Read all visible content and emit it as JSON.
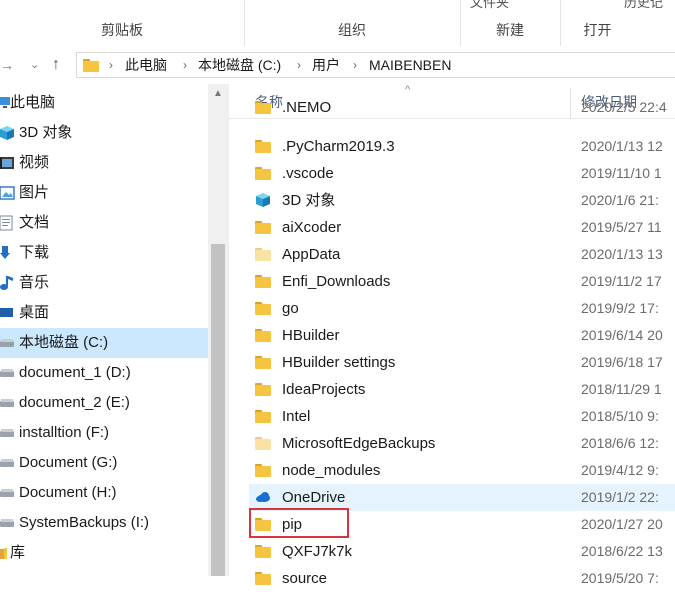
{
  "ribbon": {
    "groups": [
      {
        "label": "剪贴板"
      },
      {
        "label": "组织"
      },
      {
        "label": "新建",
        "top_stub": "文件夹"
      },
      {
        "label": "打开",
        "top_stub": "历史记"
      }
    ]
  },
  "address": {
    "back_icon": "back-arrow-icon",
    "forward_icon": "chevron-down-icon",
    "up_icon": "up-arrow-icon",
    "breadcrumbs": [
      "此电脑",
      "本地磁盘 (C:)",
      "用户",
      "MAIBENBEN"
    ]
  },
  "nav_pane": {
    "items": [
      {
        "label": "此电脑",
        "icon": "computer-icon"
      },
      {
        "label": "3D 对象",
        "icon": "cube-3d-icon"
      },
      {
        "label": "视频",
        "icon": "video-icon"
      },
      {
        "label": "图片",
        "icon": "pictures-icon"
      },
      {
        "label": "文档",
        "icon": "documents-icon"
      },
      {
        "label": "下载",
        "icon": "download-icon"
      },
      {
        "label": "音乐",
        "icon": "music-icon"
      },
      {
        "label": "桌面",
        "icon": "desktop-icon"
      },
      {
        "label": "本地磁盘 (C:)",
        "icon": "drive-icon",
        "selected": true
      },
      {
        "label": "document_1 (D:)",
        "icon": "drive-icon"
      },
      {
        "label": "document_2 (E:)",
        "icon": "drive-icon"
      },
      {
        "label": "installtion (F:)",
        "icon": "drive-icon"
      },
      {
        "label": "Document (G:)",
        "icon": "drive-icon"
      },
      {
        "label": "Document (H:)",
        "icon": "drive-icon"
      },
      {
        "label": "SystemBackups (I:)",
        "icon": "drive-icon"
      },
      {
        "label": "库",
        "icon": "library-icon"
      }
    ]
  },
  "columns": {
    "name": "名称",
    "date": "修改日期"
  },
  "files": [
    {
      "name": ".NEMO",
      "date": "2020/2/5 22:4",
      "icon": "folder-icon",
      "cut": true
    },
    {
      "name": ".PyCharm2019.3",
      "date": "2020/1/13 12",
      "icon": "folder-icon"
    },
    {
      "name": ".vscode",
      "date": "2019/11/10 1",
      "icon": "folder-icon"
    },
    {
      "name": "3D 对象",
      "date": "2020/1/6 21:",
      "icon": "cube-3d-icon"
    },
    {
      "name": "aiXcoder",
      "date": "2019/5/27 11",
      "icon": "folder-icon"
    },
    {
      "name": "AppData",
      "date": "2020/1/13 13",
      "icon": "folder-icon",
      "pale": true
    },
    {
      "name": "Enfi_Downloads",
      "date": "2019/11/2 17",
      "icon": "folder-icon"
    },
    {
      "name": "go",
      "date": "2019/9/2 17:",
      "icon": "folder-icon"
    },
    {
      "name": "HBuilder",
      "date": "2019/6/14 20",
      "icon": "folder-icon"
    },
    {
      "name": "HBuilder settings",
      "date": "2019/6/18 17",
      "icon": "folder-icon"
    },
    {
      "name": "IdeaProjects",
      "date": "2018/11/29 1",
      "icon": "folder-icon"
    },
    {
      "name": "Intel",
      "date": "2018/5/10 9:",
      "icon": "folder-icon"
    },
    {
      "name": "MicrosoftEdgeBackups",
      "date": "2018/6/6 12:",
      "icon": "folder-icon",
      "pale": true
    },
    {
      "name": "node_modules",
      "date": "2019/4/12 9:",
      "icon": "folder-icon"
    },
    {
      "name": "OneDrive",
      "date": "2019/1/2 22:",
      "icon": "onedrive-cloud-icon",
      "hover": true
    },
    {
      "name": "pip",
      "date": "2020/1/27 20",
      "icon": "folder-icon",
      "highlighted": true
    },
    {
      "name": "QXFJ7k7k",
      "date": "2018/6/22 13",
      "icon": "folder-icon"
    },
    {
      "name": "source",
      "date": "2019/5/20 7:",
      "icon": "folder-icon",
      "cut": true
    }
  ]
}
